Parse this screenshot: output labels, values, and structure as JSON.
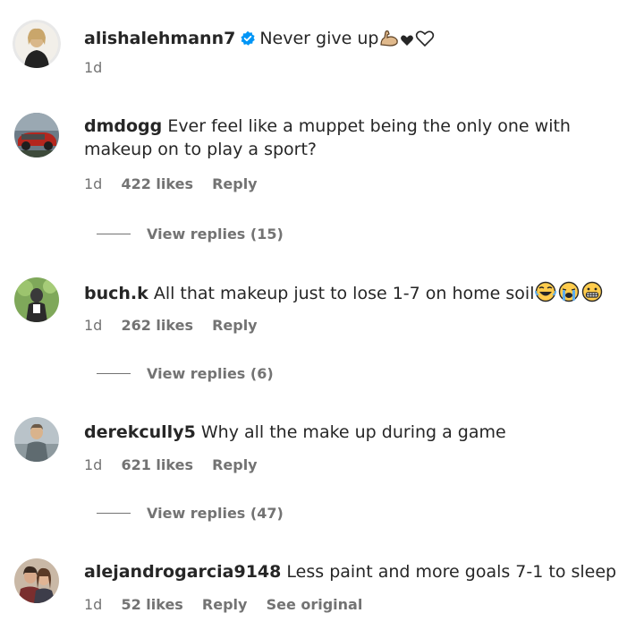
{
  "post": {
    "username": "alishalehmann7",
    "caption": "Never give up",
    "time": "1d"
  },
  "comments": [
    {
      "username": "dmdogg",
      "text": "Ever feel like a muppet being the only one with makeup on to play a sport?",
      "time": "1d",
      "likes": "422 likes",
      "reply": "Reply",
      "view_replies": "View replies (15)"
    },
    {
      "username": "buch.k",
      "text": "All that makeup just to lose 1-7 on home soil",
      "time": "1d",
      "likes": "262 likes",
      "reply": "Reply",
      "view_replies": "View replies (6)"
    },
    {
      "username": "derekcully5",
      "text": "Why all the make up during a game",
      "time": "1d",
      "likes": "621 likes",
      "reply": "Reply",
      "view_replies": "View replies (47)"
    },
    {
      "username": "alejandrogarcia9148",
      "text": "Less paint and more goals 7-1 to sleep",
      "time": "1d",
      "likes": "52 likes",
      "reply": "Reply",
      "see_original": "See original"
    }
  ],
  "icons": {
    "verified": "verified-badge-icon",
    "flexed_biceps": "flexed-biceps-emoji",
    "black_heart": "black-heart-emoji",
    "white_heart": "white-heart-emoji",
    "laughing": "tears-of-joy-emoji",
    "crying": "loudly-crying-emoji",
    "grimacing": "grimacing-emoji"
  },
  "colors": {
    "text": "#262626",
    "secondary": "#737373",
    "verified": "#0095f6"
  }
}
